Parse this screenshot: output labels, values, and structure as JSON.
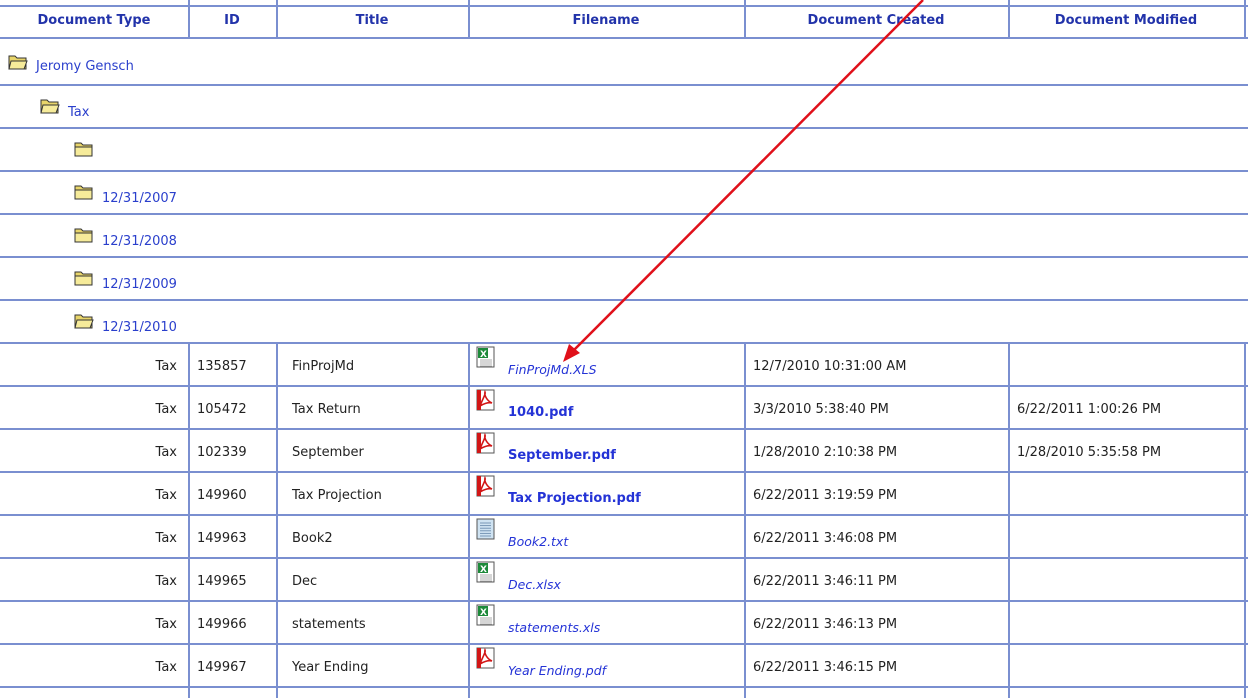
{
  "headers": [
    "Document Type",
    "ID",
    "Title",
    "Filename",
    "Document Created",
    "Document Modified"
  ],
  "folders": [
    {
      "label": "Jeromy Gensch",
      "open": true
    },
    {
      "label": "Tax",
      "open": true
    },
    {
      "label": "",
      "open": false
    },
    {
      "label": "12/31/2007",
      "open": false
    },
    {
      "label": "12/31/2008",
      "open": false
    },
    {
      "label": "12/31/2009",
      "open": false
    },
    {
      "label": "12/31/2010",
      "open": true
    }
  ],
  "rows": [
    {
      "type": "Tax",
      "id": "135857",
      "title": "FinProjMd",
      "filename": "FinProjMd.XLS",
      "icon": "excel-icon",
      "style": "italic",
      "created": "12/7/2010 10:31:00 AM",
      "modified": ""
    },
    {
      "type": "Tax",
      "id": "105472",
      "title": "Tax Return",
      "filename": "1040.pdf",
      "icon": "pdf-icon",
      "style": "bold",
      "created": "3/3/2010 5:38:40 PM",
      "modified": "6/22/2011 1:00:26 PM"
    },
    {
      "type": "Tax",
      "id": "102339",
      "title": "September",
      "filename": "September.pdf",
      "icon": "pdf-icon",
      "style": "bold",
      "created": "1/28/2010 2:10:38 PM",
      "modified": "1/28/2010 5:35:58 PM"
    },
    {
      "type": "Tax",
      "id": "149960",
      "title": "Tax Projection",
      "filename": "Tax Projection.pdf",
      "icon": "pdf-icon",
      "style": "bold",
      "created": "6/22/2011 3:19:59 PM",
      "modified": ""
    },
    {
      "type": "Tax",
      "id": "149963",
      "title": "Book2",
      "filename": "Book2.txt",
      "icon": "text-file-icon",
      "style": "italic",
      "created": "6/22/2011 3:46:08 PM",
      "modified": ""
    },
    {
      "type": "Tax",
      "id": "149965",
      "title": "Dec",
      "filename": "Dec.xlsx",
      "icon": "excel-icon",
      "style": "italic",
      "created": "6/22/2011 3:46:11 PM",
      "modified": ""
    },
    {
      "type": "Tax",
      "id": "149966",
      "title": "statements",
      "filename": "statements.xls",
      "icon": "excel-icon",
      "style": "italic",
      "created": "6/22/2011 3:46:13 PM",
      "modified": ""
    },
    {
      "type": "Tax",
      "id": "149967",
      "title": "Year Ending",
      "filename": "Year Ending.pdf",
      "icon": "pdf-icon",
      "style": "italic",
      "created": "6/22/2011 3:46:15 PM",
      "modified": ""
    }
  ],
  "colors": {
    "grid": "#7a8fd0",
    "header_text": "#2233aa",
    "link": "#2433d6",
    "arrow": "#e0101a"
  }
}
